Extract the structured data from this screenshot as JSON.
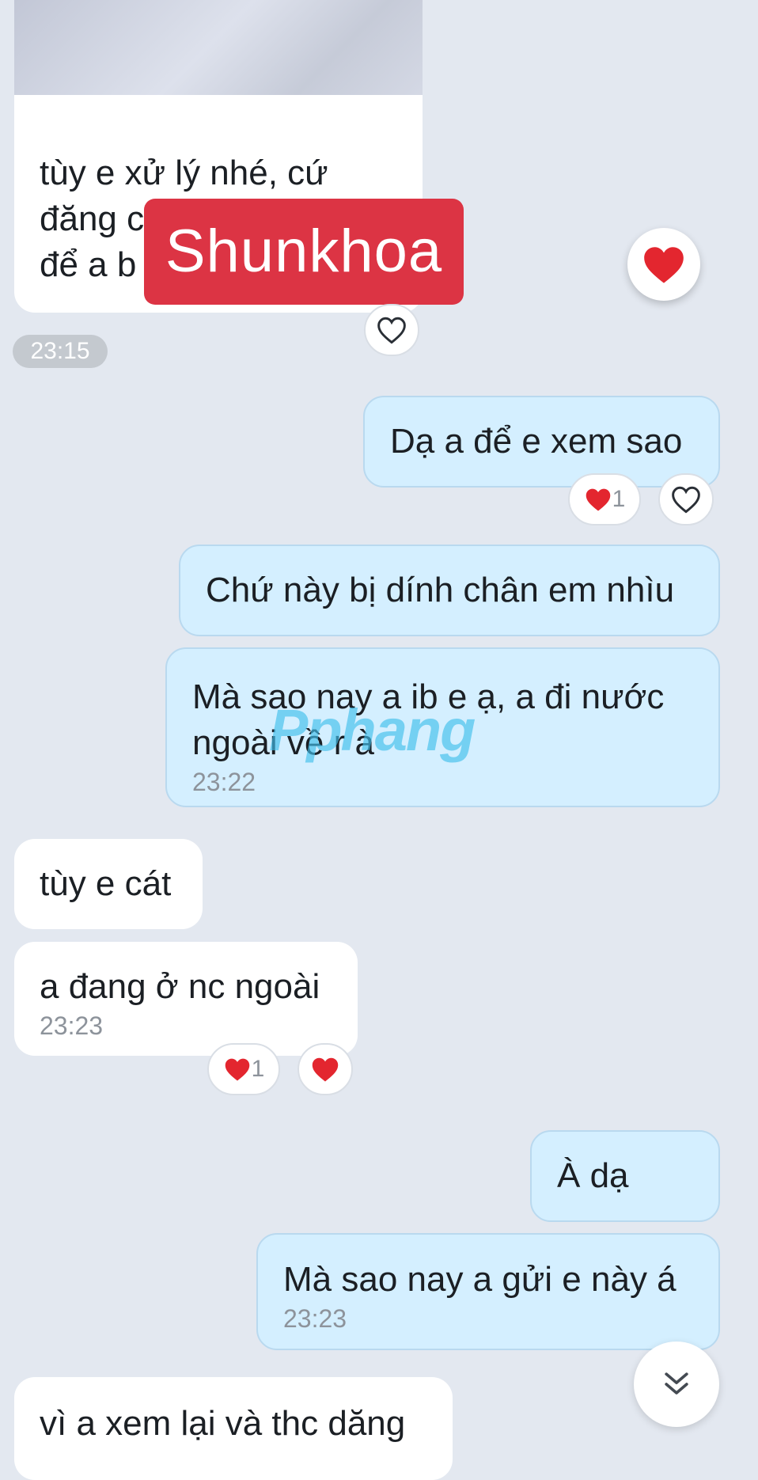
{
  "colors": {
    "background": "#e3e8f0",
    "incoming_bubble": "#ffffff",
    "outgoing_bubble": "#d4efff",
    "heart_red": "#e3262f",
    "overlay_red": "#dc3444",
    "watermark_blue": "#40beeb"
  },
  "overlays": {
    "brand_label": "Shunkhoa",
    "watermark": "Pphang"
  },
  "messages": [
    {
      "id": "m1",
      "side": "in",
      "lines": [
        "tùy e xử lý nhé, cứ",
        "đăng c",
        "để a b"
      ],
      "attachment": "photo"
    },
    {
      "id": "stamp1",
      "text": "23:15"
    },
    {
      "id": "m2",
      "side": "out",
      "text": "Dạ a để e xem sao",
      "reaction_count": "1"
    },
    {
      "id": "m3",
      "side": "out",
      "text": "Chứ này bị dính chân em nhìu"
    },
    {
      "id": "m4",
      "side": "out",
      "lines": [
        "Mà sao nay a ib e ạ, a đi nước",
        "ngoài về r à"
      ],
      "time": "23:22"
    },
    {
      "id": "m5",
      "side": "in",
      "text": "tùy e cát"
    },
    {
      "id": "m6",
      "side": "in",
      "text": "a đang ở nc ngoài",
      "time": "23:23",
      "reaction_count": "1"
    },
    {
      "id": "m7",
      "side": "out",
      "text": "À dạ"
    },
    {
      "id": "m8",
      "side": "out",
      "text": "Mà sao nay a gửi e này á",
      "time": "23:23"
    },
    {
      "id": "m9",
      "side": "in",
      "text": "vì a xem lại và thc dăng"
    }
  ],
  "icons": {
    "reaction_heart": "heart-icon",
    "reaction_outline": "heart-outline-icon",
    "scroll_down": "double-chevron-down-icon"
  }
}
